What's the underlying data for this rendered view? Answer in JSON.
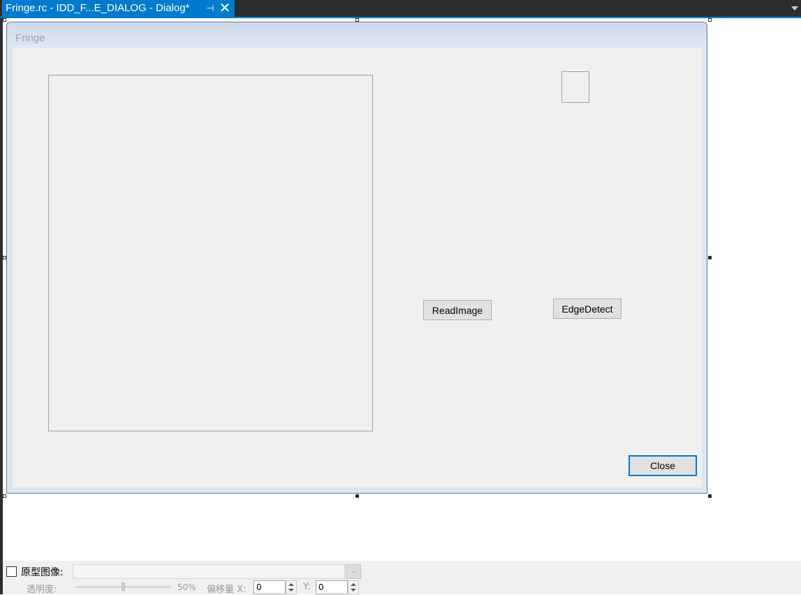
{
  "tab": {
    "title": "Fringe.rc - IDD_F...E_DIALOG - Dialog*",
    "pin_glyph": "⊣",
    "close_glyph": "✕"
  },
  "dialog": {
    "title": "Fringe",
    "buttons": {
      "read_image": "ReadImage",
      "edge_detect": "EdgeDetect",
      "close": "Close"
    }
  },
  "guide_bar": {
    "prototype_label": "原型图像:",
    "browse_label": "..",
    "opacity_label": "透明度:",
    "opacity_value": "50%",
    "opacity_fraction": 0.5,
    "offset_label": "偏移量 X:",
    "x_value": "0",
    "y_label": "Y:",
    "y_value": "0"
  }
}
